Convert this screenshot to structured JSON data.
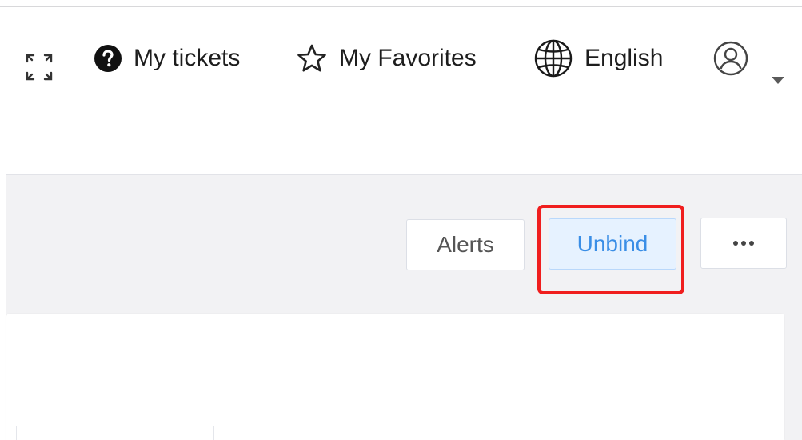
{
  "header": {
    "fullscreen_icon": "fullscreen-expand-icon",
    "tickets": {
      "label": "My tickets",
      "icon": "question-circle-icon"
    },
    "favorites": {
      "label": "My Favorites",
      "icon": "star-outline-icon"
    },
    "language": {
      "label": "English",
      "icon": "globe-icon"
    },
    "user": {
      "icon": "user-avatar-icon",
      "dropdown_icon": "caret-down-icon"
    }
  },
  "toolbar": {
    "alerts_label": "Alerts",
    "unbind_label": "Unbind",
    "more_icon": "more-dots-icon"
  },
  "highlight": {
    "target": "Unbind",
    "color": "#f01e1e"
  },
  "colors": {
    "accent": "#3a8ee6",
    "accent_bg": "#e6f2ff",
    "page_bg": "#f2f2f4"
  }
}
